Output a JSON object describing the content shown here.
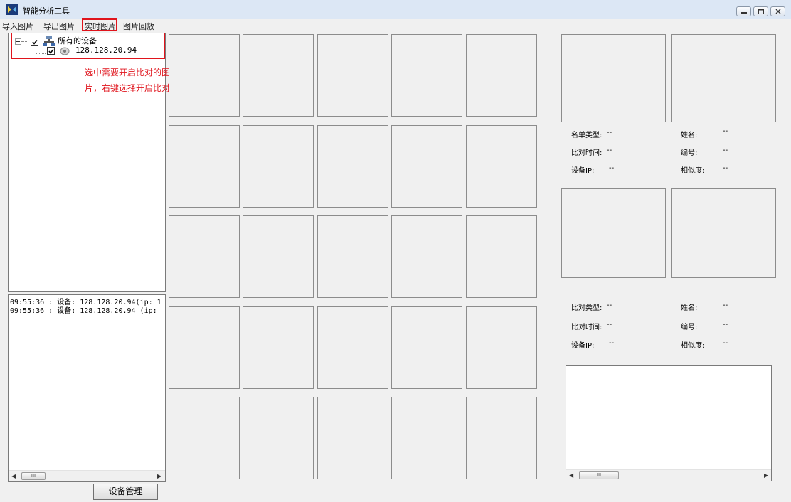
{
  "window": {
    "title": "智能分析工具"
  },
  "menu": [
    {
      "label": "导入图片"
    },
    {
      "label": "导出图片"
    },
    {
      "label": "实时图片"
    },
    {
      "label": "图片回放"
    }
  ],
  "tree": {
    "root_label": "所有的设备",
    "device_ip": "128.128.20.94"
  },
  "annotation_lines": [
    "选中需要开启比对的图",
    "片，右键选择开启比对"
  ],
  "log_lines": [
    "09:55:36 : 设备: 128.128.20.94(ip: 1",
    "09:55:36 : 设备: 128.128.20.94 (ip:"
  ],
  "scroll_glyph": "III",
  "device_button": "设备管理",
  "compare_top": {
    "list_type_label": "名单类型:",
    "list_type_value": "--",
    "name_label": "姓名:",
    "name_value": "--",
    "time_label": "比对时间:",
    "time_value": "--",
    "id_label": "编号:",
    "id_value": "--",
    "ip_label": "设备IP:",
    "ip_value": "--",
    "similarity_label": "相似度:",
    "similarity_value": "--"
  },
  "compare_bottom": {
    "type_label": "比对类型:",
    "type_value": "--",
    "name_label": "姓名:",
    "name_value": "--",
    "time_label": "比对时间:",
    "time_value": "--",
    "id_label": "编号:",
    "id_value": "--",
    "ip_label": "设备IP:",
    "ip_value": "--",
    "similarity_label": "相似度:",
    "similarity_value": "--"
  },
  "colors": {
    "highlight": "#e0141c",
    "titlebar": "#dce7f5"
  }
}
